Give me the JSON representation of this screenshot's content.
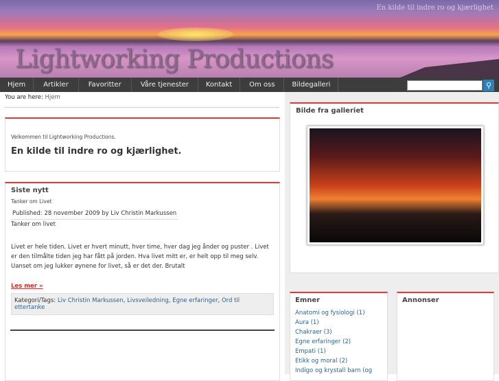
{
  "header": {
    "logo": "Lightworking Productions",
    "tagline": "En kilde til indre ro og kjærlighet"
  },
  "nav": [
    "Hjem",
    "Artikler",
    "Favoritter",
    "Våre tjenester",
    "Kontakt",
    "Om oss",
    "Bildegalleri"
  ],
  "search": {
    "placeholder": "",
    "icon": "search-icon"
  },
  "breadcrumb": {
    "label": "You are here:",
    "current": "Hjem"
  },
  "welcome": {
    "small": "Velkommen til Lightworking Productions.",
    "title": "En kilde til indre ro og kjærlighet."
  },
  "news": {
    "heading": "Siste nytt",
    "subtitle": "Tanker om Livet",
    "published": "Published: 28 november 2009 by Liv Christin Markussen",
    "intro": "Tanker om livet",
    "body": "Livet er hele tiden. Livet er hvert minutt, hver time, hver dag jeg ånder og puster . Livet er den tilmålte tiden jeg har fått på jorden. Hva livet mitt er, er helt opp til meg selv. Uanset om jeg lukker øynene for livet, så er det der. Brutalt",
    "more": "Les mer »",
    "tags_label": "Kategori/Tags:",
    "tags": [
      "Liv Christin Markussen",
      "Livsveiledning",
      "Egne erfaringer",
      "Ord til ettertanke"
    ]
  },
  "gallery": {
    "heading": "Bilde fra galleriet"
  },
  "emner": {
    "heading": "Emner",
    "items": [
      "Anatomi og fysiologi (1)",
      "Aura (1)",
      "Chakraer (3)",
      "Egne erfaringer (2)",
      "Empati (1)",
      "Etikk og moral (2)",
      "Indigo og krystall barn (og"
    ]
  },
  "annonser": {
    "heading": "Annonser"
  }
}
